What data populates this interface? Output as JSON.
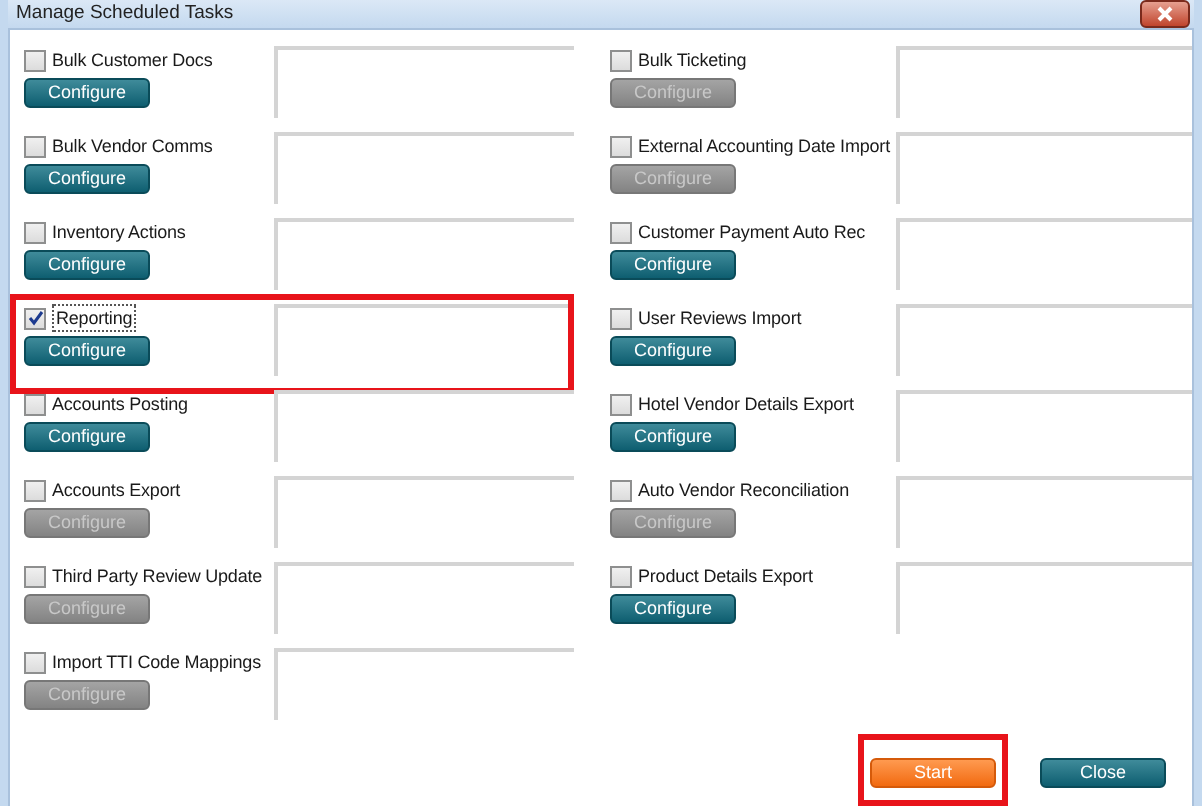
{
  "window": {
    "title": "Manage Scheduled Tasks"
  },
  "columns": [
    {
      "tasks": [
        {
          "name": "Bulk Customer Docs",
          "checked": false,
          "configure": "Configure",
          "disabled": false,
          "highlighted": false
        },
        {
          "name": "Bulk Vendor Comms",
          "checked": false,
          "configure": "Configure",
          "disabled": false,
          "highlighted": false
        },
        {
          "name": "Inventory Actions",
          "checked": false,
          "configure": "Configure",
          "disabled": false,
          "highlighted": false
        },
        {
          "name": "Reporting",
          "checked": true,
          "configure": "Configure",
          "disabled": false,
          "highlighted": true
        },
        {
          "name": "Accounts Posting",
          "checked": false,
          "configure": "Configure",
          "disabled": false,
          "highlighted": false
        },
        {
          "name": "Accounts Export",
          "checked": false,
          "configure": "Configure",
          "disabled": true,
          "highlighted": false
        },
        {
          "name": "Third Party Review Update",
          "checked": false,
          "configure": "Configure",
          "disabled": true,
          "highlighted": false
        },
        {
          "name": "Import TTI Code Mappings",
          "checked": false,
          "configure": "Configure",
          "disabled": true,
          "highlighted": false
        }
      ]
    },
    {
      "tasks": [
        {
          "name": "Bulk Ticketing",
          "checked": false,
          "configure": "Configure",
          "disabled": true,
          "highlighted": false
        },
        {
          "name": "External Accounting Date Import",
          "checked": false,
          "configure": "Configure",
          "disabled": true,
          "highlighted": false
        },
        {
          "name": "Customer Payment Auto Rec",
          "checked": false,
          "configure": "Configure",
          "disabled": false,
          "highlighted": false
        },
        {
          "name": "User Reviews Import",
          "checked": false,
          "configure": "Configure",
          "disabled": false,
          "highlighted": false
        },
        {
          "name": "Hotel Vendor Details Export",
          "checked": false,
          "configure": "Configure",
          "disabled": false,
          "highlighted": false
        },
        {
          "name": "Auto Vendor Reconciliation",
          "checked": false,
          "configure": "Configure",
          "disabled": true,
          "highlighted": false
        },
        {
          "name": "Product Details Export",
          "checked": false,
          "configure": "Configure",
          "disabled": false,
          "highlighted": false
        }
      ]
    }
  ],
  "buttons": [
    {
      "label": "Start",
      "kind": "primary",
      "highlighted": true
    },
    {
      "label": "Close",
      "kind": "secondary",
      "highlighted": false
    }
  ]
}
